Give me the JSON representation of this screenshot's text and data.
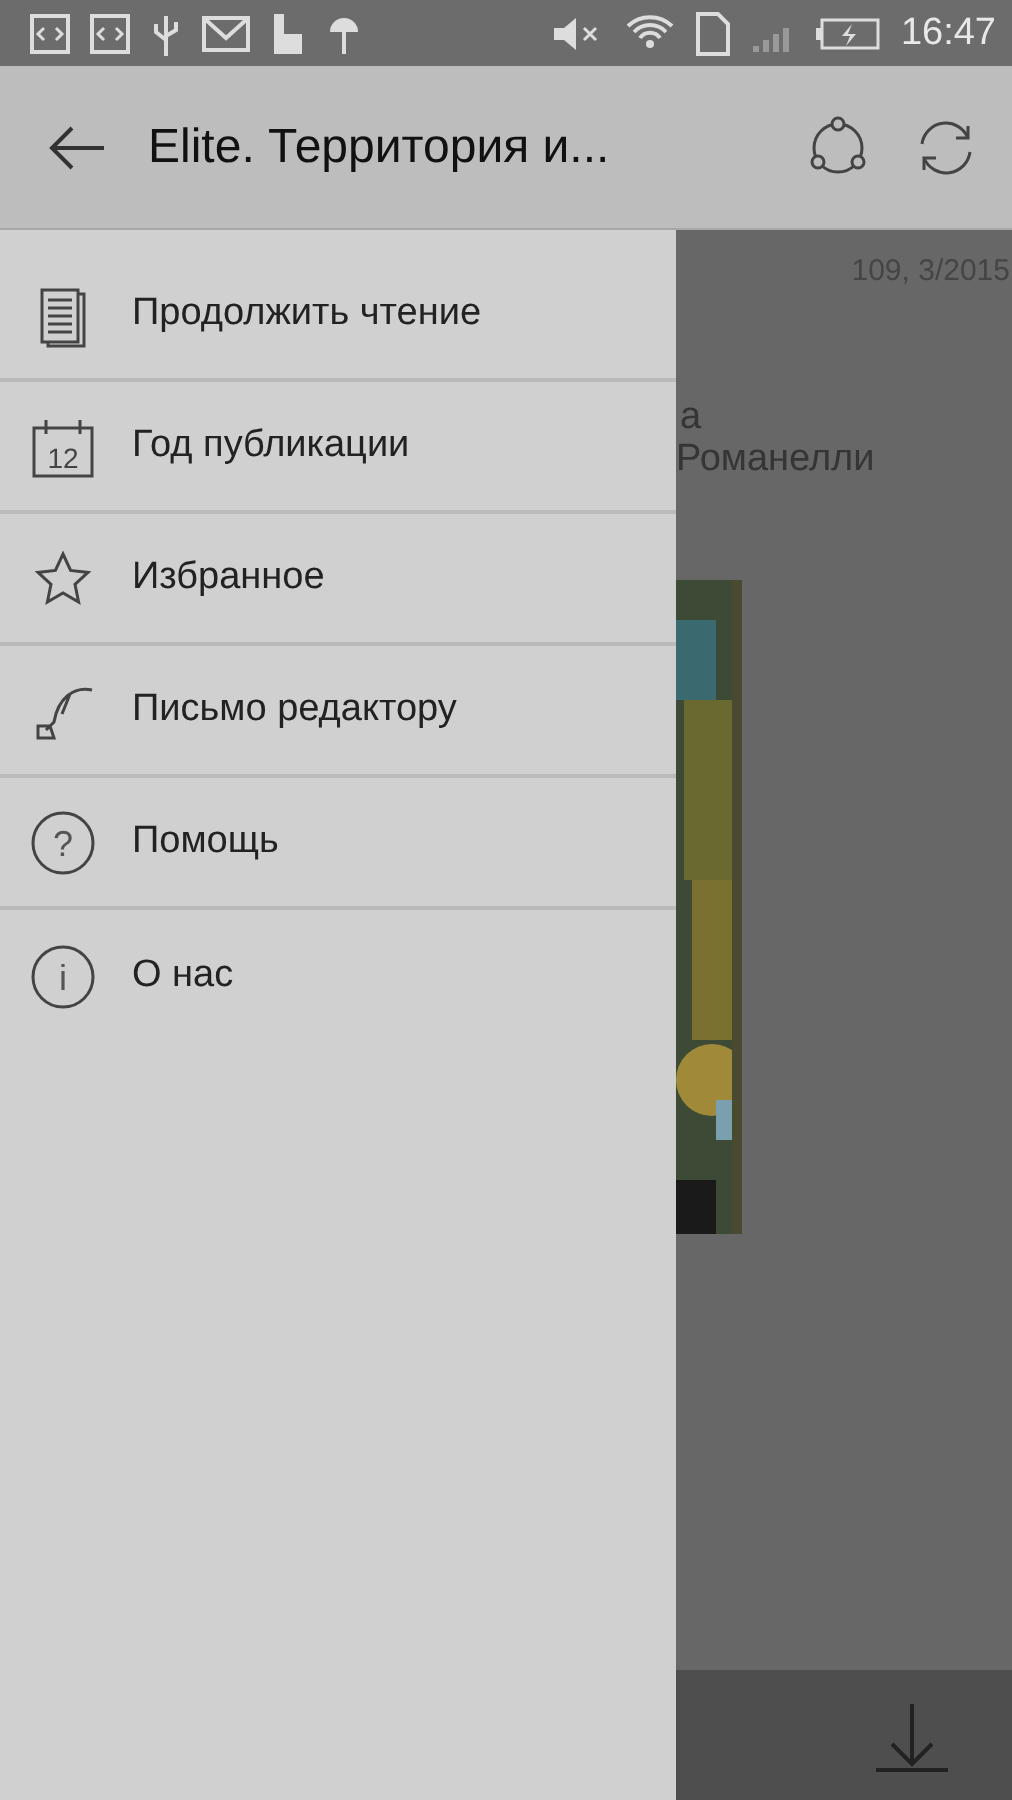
{
  "status_bar": {
    "time": "16:47"
  },
  "toolbar": {
    "title": "Elite. Территория и..."
  },
  "drawer": {
    "items": [
      {
        "kind": "reading",
        "label": "Продолжить чтение"
      },
      {
        "kind": "calendar",
        "label": "Год публикации",
        "icon_text": "12"
      },
      {
        "kind": "star",
        "label": "Избранное"
      },
      {
        "kind": "quill",
        "label": "Письмо редактору"
      },
      {
        "kind": "help",
        "label": "Помощь",
        "icon_text": "?"
      },
      {
        "kind": "info",
        "label": "О нас",
        "icon_text": "i"
      }
    ]
  },
  "content": {
    "issue": "109, 3/2015",
    "line_1": "а",
    "line_2": "Романелли"
  }
}
